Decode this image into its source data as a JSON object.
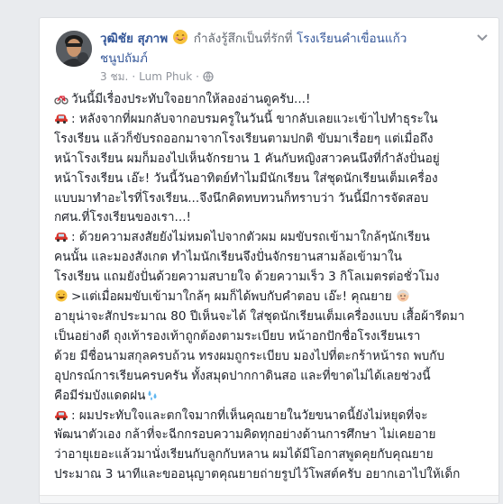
{
  "post": {
    "author": "วุฒิชัย สุภาพ",
    "feeling_text": "กำลังรู้สึกเป็นที่รักที่",
    "place_line1": "โรงเรียนคำเขื่อนแก้ว",
    "place_line2": "ชนูปถัมภ์",
    "time": "3 ชม.",
    "location": "Lum Phuk",
    "colors": {
      "author_link": "#365899",
      "meta": "#90949c",
      "text": "#1d2129",
      "card_border": "#dddfe2",
      "background": "#e9ebee"
    },
    "icons": [
      "avatar",
      "feeling-emoji-icon",
      "options-chevron-icon",
      "dot-separator",
      "globe-icon",
      "bicycle-icon",
      "car-icon",
      "grin-emoji-icon",
      "old-man-emoji-icon",
      "droplets-icon"
    ],
    "paragraphs": [
      {
        "icon": "bicycle-icon",
        "lines": [
          "วันนี้มีเรื่องประทับใจอยากให้ลองอ่านดูครับ...!"
        ]
      },
      {
        "icon": "car-icon",
        "lines": [
          ": หลังจากที่ผมกลับจากอบรมครูในวันนี้ ขากลับเลยแวะเข้าไปทำธุระใน",
          "โรงเรียน แล้วก็ขับรถออกมาจากโรงเรียนตามปกติ ขับมาเรื่อยๆ แต่เมื่อถึง",
          "หน้าโรงเรียน ผมก็มองไปเห็นจักรยาน 1 คันกับหญิงสาวคนนึงที่กำลังปั่นอยู่",
          "หน้าโรงเรียน เอ๊ะ! วันนี้วันอาทิตย์ทำไมมีนักเรียน ใส่ชุดนักเรียนเต็มเครื่อง",
          "แบบมาทำอะไรที่โรงเรียน...จึงนึกคิดทบทวนก็ทราบว่า วันนี้มีการจัดสอบ",
          "กศน.ที่โรงเรียนของเรา...!"
        ]
      },
      {
        "icon": "car-icon",
        "lines": [
          ": ด้วยความสงสัยยังไม่หมดไปจากตัวผม ผมขับรถเข้ามาใกล้ๆนักเรียน",
          "คนนั้น และมองสังเกต ทำไมนักเรียนจึงปั่นจักรยานสามล้อเข้ามาใน",
          "โรงเรียน แถมยังปั่นด้วยความสบายใจ ด้วยความเร็ว 3 กิโลเมตรต่อชั่วโมง",
          ">แต่เมื่อผมขับเข้ามาใกล้ๆ ผมก็ได้พบกับคำตอบ เอ๊ะ! คุณยาย",
          "อายุน่าจะสักประมาณ 80 ปีเห็นจะได้ ใส่ชุดนักเรียนเต็มเครื่องแบบ เสื้อผ้ารีดมา",
          "เป็นอย่างดี ถุงเท้ารองเท้าถูกต้องตามระเบียบ หน้าอกปักชื่อโรงเรียนเรา",
          "ด้วย มีชื่อนามสกุลครบถ้วน ทรงผมถูกระเบียบ มองไปที่ตะกร้าหน้ารถ พบกับ",
          "อุปกรณ์การเรียนครบครัน ทั้งสมุดปากกาดินสอ และที่ขาดไม่ได้เลยช่วงนี้",
          "คือมีร่มบังแดดฝน"
        ]
      },
      {
        "icon": "car-icon",
        "lines": [
          ": ผมประทับใจและตกใจมากที่เห็นคุณยายในวัยขนาดนี้ยังไม่หยุดที่จะ",
          "พัฒนาตัวเอง กล้าที่จะฉีกกรอบความคิดทุกอย่างด้านการศึกษา ไม่เคยอาย",
          "ว่าอายุเยอะแล้วมานั่งเรียนกับลูกกับหลาน ผมได้มีโอกาสพูดคุยกับคุณยาย",
          "ประมาณ 3 นาทีและขออนุญาตคุณยายถ่ายรูปไว้โพสต์ครับ อยากเอาไปให้เด็ก"
        ]
      }
    ]
  }
}
